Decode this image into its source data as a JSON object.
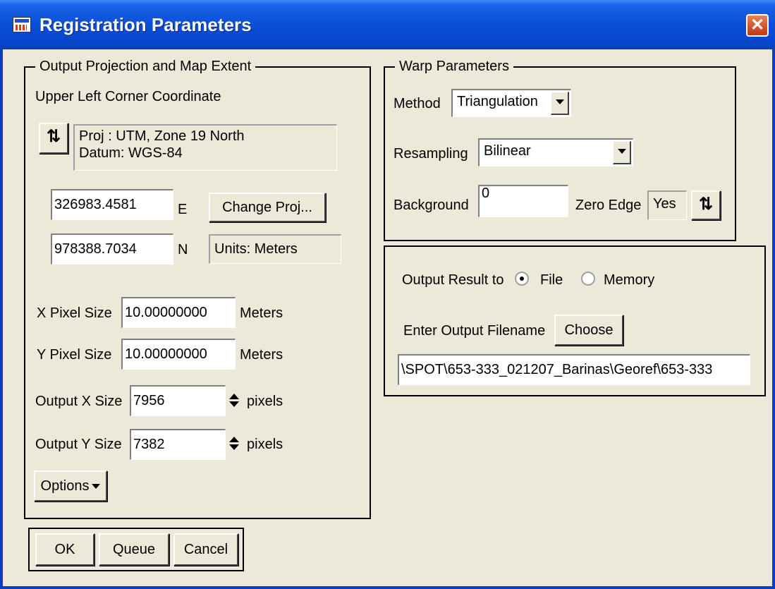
{
  "window": {
    "title": "Registration Parameters",
    "close_glyph": "✕"
  },
  "output_group": {
    "title": "Output Projection and Map Extent",
    "upper_left_label": "Upper Left Corner Coordinate",
    "toggle_glyph": "⇅",
    "proj_line1": "Proj : UTM, Zone 19 North",
    "proj_line2": "Datum: WGS-84",
    "easting_value": "326983.4581",
    "easting_unit": "E",
    "northing_value": "978388.7034",
    "northing_unit": "N",
    "change_proj_label": "Change Proj...",
    "units_label": "Units: Meters",
    "x_pixel_label": "X Pixel Size",
    "x_pixel_value": "10.00000000",
    "x_pixel_unit": "Meters",
    "y_pixel_label": "Y Pixel Size",
    "y_pixel_value": "10.00000000",
    "y_pixel_unit": "Meters",
    "out_x_label": "Output X Size",
    "out_x_value": "7956",
    "out_x_unit": "pixels",
    "out_y_label": "Output Y Size",
    "out_y_value": "7382",
    "out_y_unit": "pixels",
    "options_label": "Options"
  },
  "buttons": {
    "ok": "OK",
    "queue": "Queue",
    "cancel": "Cancel"
  },
  "warp_group": {
    "title": "Warp Parameters",
    "method_label": "Method",
    "method_value": "Triangulation",
    "resampling_label": "Resampling",
    "resampling_value": "Bilinear",
    "background_label": "Background",
    "background_value": "0",
    "zero_edge_label": "Zero Edge",
    "zero_edge_value": "Yes",
    "toggle_glyph": "⇅"
  },
  "output_result": {
    "label": "Output Result to",
    "file_label": "File",
    "memory_label": "Memory",
    "selected": "File",
    "filename_label": "Enter Output Filename",
    "choose_label": "Choose",
    "filename_value": "\\SPOT\\653-333_021207_Barinas\\Georef\\653-333"
  }
}
